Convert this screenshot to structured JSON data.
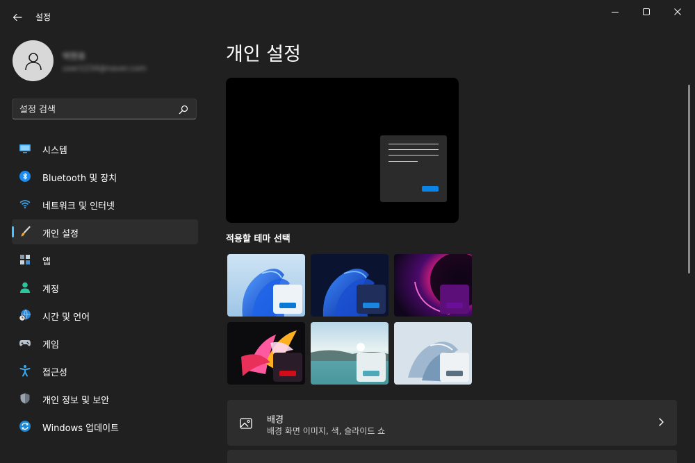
{
  "window": {
    "title": "설정",
    "controls": [
      "minimize",
      "maximize",
      "close"
    ]
  },
  "user": {
    "name": "박현호",
    "email": "user1234@naver.com"
  },
  "search": {
    "placeholder": "설정 검색"
  },
  "sidebar": {
    "selected_index": 3,
    "items": [
      {
        "label": "시스템",
        "icon": "system-icon"
      },
      {
        "label": "Bluetooth 및 장치",
        "icon": "bluetooth-icon"
      },
      {
        "label": "네트워크 및 인터넷",
        "icon": "wifi-icon"
      },
      {
        "label": "개인 설정",
        "icon": "brush-icon"
      },
      {
        "label": "앱",
        "icon": "apps-icon"
      },
      {
        "label": "계정",
        "icon": "account-icon"
      },
      {
        "label": "시간 및 언어",
        "icon": "globe-clock-icon"
      },
      {
        "label": "게임",
        "icon": "gamepad-icon"
      },
      {
        "label": "접근성",
        "icon": "accessibility-icon"
      },
      {
        "label": "개인 정보 및 보안",
        "icon": "shield-icon"
      },
      {
        "label": "Windows 업데이트",
        "icon": "update-icon"
      }
    ]
  },
  "main": {
    "title": "개인 설정",
    "theme_section_label": "적용할 테마 선택",
    "themes": [
      {
        "id": "windows-light",
        "accent": "#0a78d4"
      },
      {
        "id": "windows-dark",
        "accent": "#1a86e0"
      },
      {
        "id": "glow",
        "accent": "#6a0f9a"
      },
      {
        "id": "captured-motion",
        "accent": "#d10d19"
      },
      {
        "id": "sunrise",
        "accent": "#4fa8b8"
      },
      {
        "id": "flow",
        "accent": "#5a6f80"
      }
    ],
    "cards": [
      {
        "title": "배경",
        "description": "배경 화면 이미지, 색, 슬라이드 쇼",
        "icon": "image-icon"
      }
    ]
  },
  "colors": {
    "background": "#202020",
    "card": "#2d2d2d",
    "accent": "#4cc2ff"
  }
}
